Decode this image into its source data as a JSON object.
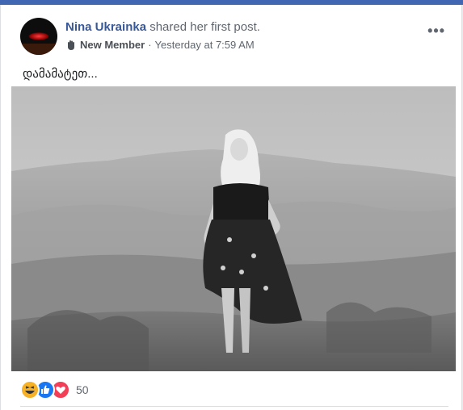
{
  "post": {
    "author": "Nina Ukrainka",
    "action": "shared her first post.",
    "badge": "New Member",
    "separator": "·",
    "timestamp": "Yesterday at 7:59 AM",
    "more_label": "•••",
    "text": "დამამატეთ..."
  },
  "reactions": {
    "icons": [
      "haha-icon",
      "like-icon",
      "love-icon"
    ],
    "count": "50"
  },
  "colors": {
    "brand": "#4267b2",
    "link": "#385898",
    "like": "#1877f2",
    "love": "#f33e58",
    "haha": "#f7b125"
  }
}
